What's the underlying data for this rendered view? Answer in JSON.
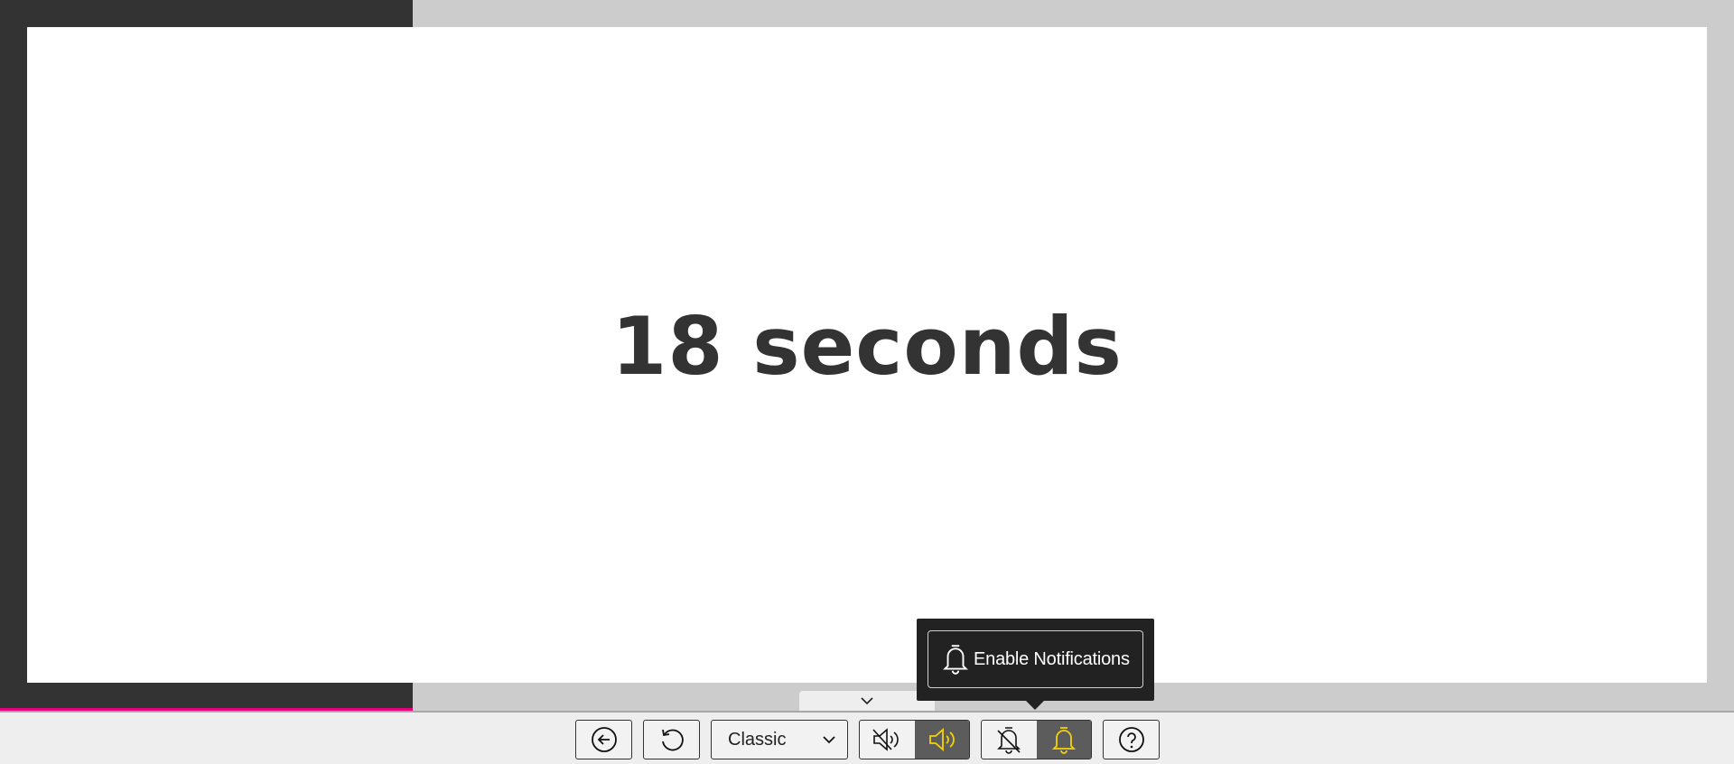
{
  "timer": {
    "display": "18 seconds"
  },
  "toolbar": {
    "back_button": {
      "icon": "arrow-left-circle-icon"
    },
    "reset_button": {
      "icon": "rotate-ccw-icon"
    },
    "theme_select": {
      "selected": "Classic",
      "icon": "chevron-down-icon"
    },
    "sound_group": {
      "mute": {
        "icon": "volume-mute-icon",
        "active": false
      },
      "sound_on": {
        "icon": "volume-on-icon",
        "active": true
      }
    },
    "notify_group": {
      "disable": {
        "icon": "bell-off-icon",
        "active": false
      },
      "enable": {
        "icon": "bell-icon",
        "active": true
      }
    },
    "help_button": {
      "icon": "help-circle-icon"
    },
    "collapse_icon": "chevron-down-icon"
  },
  "tooltip": {
    "label": "Enable Notifications",
    "icon": "bell-icon"
  },
  "colors": {
    "accent": "#f5d300",
    "progress": "#e6007e",
    "dark_panel": "#333333",
    "tooltip_bg": "#222222"
  }
}
